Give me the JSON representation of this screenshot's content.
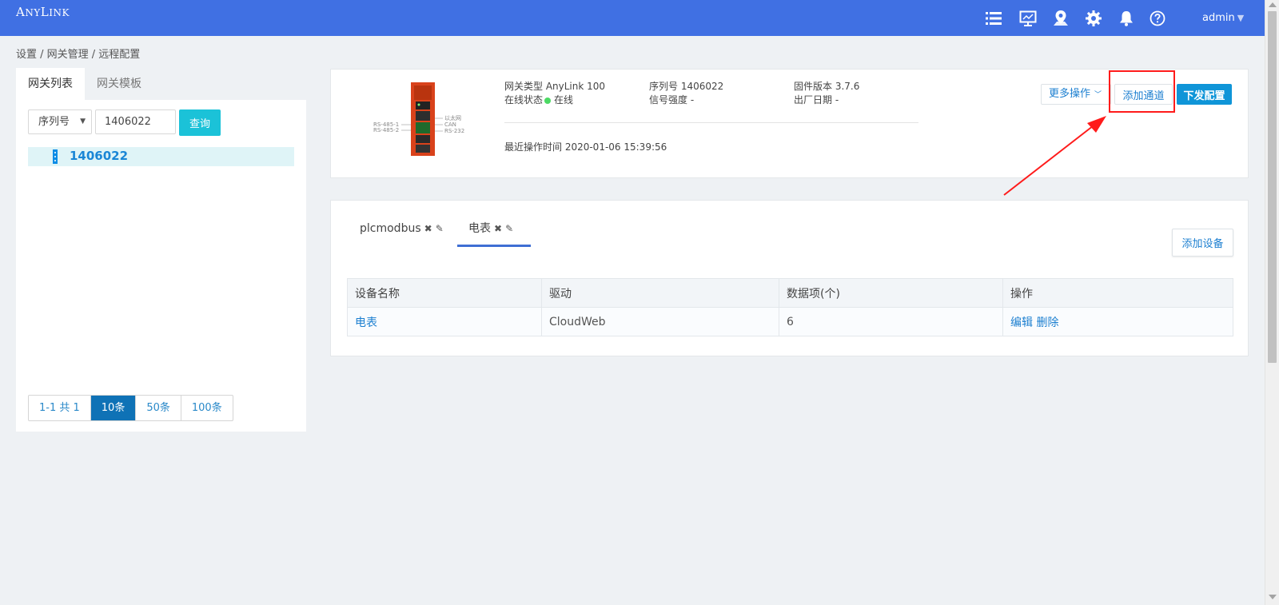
{
  "header": {
    "logo": "ANYLINK",
    "username": "admin",
    "icons": [
      "list-icon",
      "monitor-icon",
      "map-pin-icon",
      "gear-icon",
      "bell-icon",
      "help-icon"
    ],
    "bg_color": "#4070e3"
  },
  "breadcrumb": "设置 / 网关管理 / 远程配置",
  "left_panel": {
    "tabs": [
      "网关列表",
      "网关模板"
    ],
    "filter_select": "序列号",
    "search_value": "1406022",
    "query_label": "查询",
    "gateways": [
      "1406022"
    ],
    "pager": {
      "summary": "1-1 共 1",
      "sizes": [
        "10条",
        "50条",
        "100条"
      ],
      "active_size": "10条"
    }
  },
  "gateway_info": {
    "type_label": "网关类型 AnyLink 100",
    "status_label": "在线状态",
    "status_value": "在线",
    "serial_label": "序列号 1406022",
    "signal_label": "信号强度 -",
    "firmware_label": "固件版本 3.7.6",
    "factory_date_label": "出厂日期 -",
    "last_op": "最近操作时间 2020-01-06 15:39:56",
    "more_actions": "更多操作",
    "add_channel": "添加通道",
    "push_config": "下发配置",
    "device_ports": {
      "left": [
        "RS-485-1",
        "RS-485-2"
      ],
      "right": [
        "以太网",
        "CAN",
        "RS-232"
      ]
    }
  },
  "channels": {
    "tabs": [
      {
        "label": "plcmodbus",
        "active": false
      },
      {
        "label": "电表",
        "active": true
      }
    ],
    "add_device": "添加设备",
    "table": {
      "columns": [
        "设备名称",
        "驱动",
        "数据项(个)",
        "操作"
      ],
      "rows": [
        {
          "name": "电表",
          "driver": "CloudWeb",
          "items": "6",
          "edit": "编辑",
          "delete": "删除"
        }
      ]
    }
  },
  "annotation_color": "#ff1b1b"
}
